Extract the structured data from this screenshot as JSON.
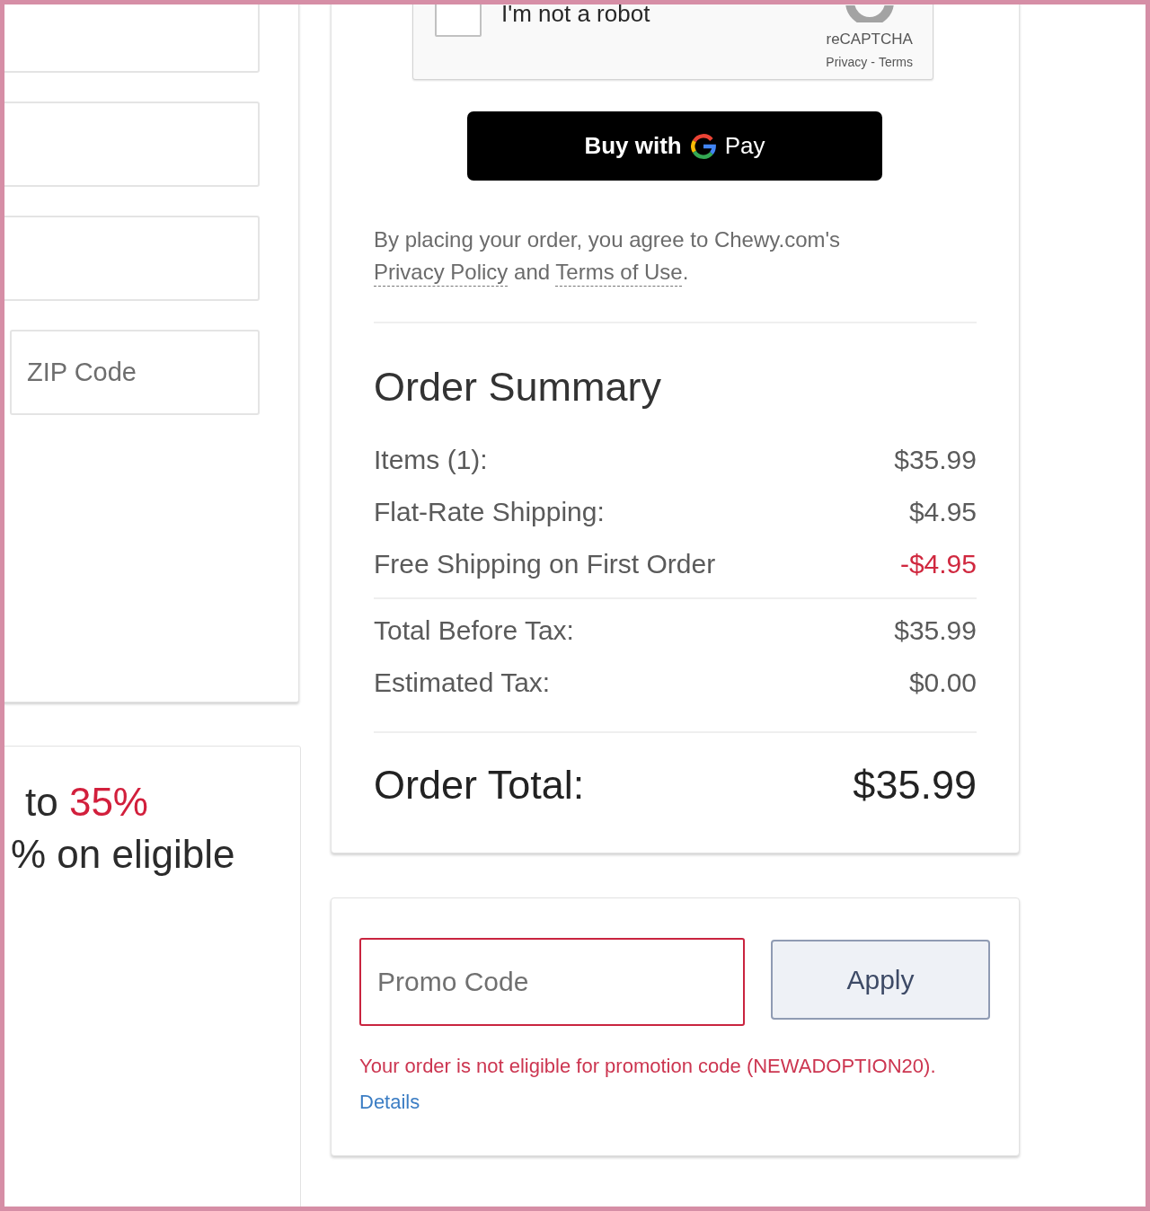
{
  "address_form": {
    "fields": [
      {
        "kind": "wide"
      },
      {
        "kind": "wide"
      },
      {
        "kind": "wide"
      },
      {
        "kind": "narrow",
        "placeholder": "ZIP Code"
      }
    ]
  },
  "offer": {
    "lines": [
      [
        {
          "text": "to ",
          "highlight": false
        },
        {
          "text": "35%",
          "highlight": true
        }
      ],
      [
        {
          "text": "% on eligible",
          "highlight": false
        }
      ]
    ]
  },
  "captcha": {
    "checked": false,
    "label": "I'm not a robot",
    "brand": "reCAPTCHA",
    "links": [
      "Privacy",
      "Terms"
    ],
    "separator": "-"
  },
  "pay_button": {
    "lead": "Buy with",
    "trail": "Pay"
  },
  "legal_text": [
    {
      "text": "By placing your order, you agree to Chewy.com's ",
      "link": false
    },
    {
      "text": "Privacy Policy",
      "link": true
    },
    {
      "text": " and ",
      "link": false
    },
    {
      "text": "Terms of Use",
      "link": true
    },
    {
      "text": ".",
      "link": false
    }
  ],
  "order_summary": {
    "title": "Order Summary",
    "sections": [
      {
        "rows": [
          {
            "label": "Items (1):",
            "value": "$35.99",
            "kind": "charge"
          },
          {
            "label": "Flat-Rate Shipping:",
            "value": "$4.95",
            "kind": "charge"
          },
          {
            "label": "Free Shipping on First Order",
            "value": "-$4.95",
            "kind": "discount"
          }
        ]
      },
      {
        "rows": [
          {
            "label": "Total Before Tax:",
            "value": "$35.99",
            "kind": "charge"
          },
          {
            "label": "Estimated Tax:",
            "value": "$0.00",
            "kind": "charge"
          }
        ]
      }
    ],
    "total": {
      "label": "Order Total:",
      "value": "$35.99"
    }
  },
  "promo": {
    "placeholder": "Promo Code",
    "invalid": true,
    "button": "Apply",
    "message": "Your order is not eligible for promotion code (NEWADOPTION20).",
    "link": "Details"
  }
}
